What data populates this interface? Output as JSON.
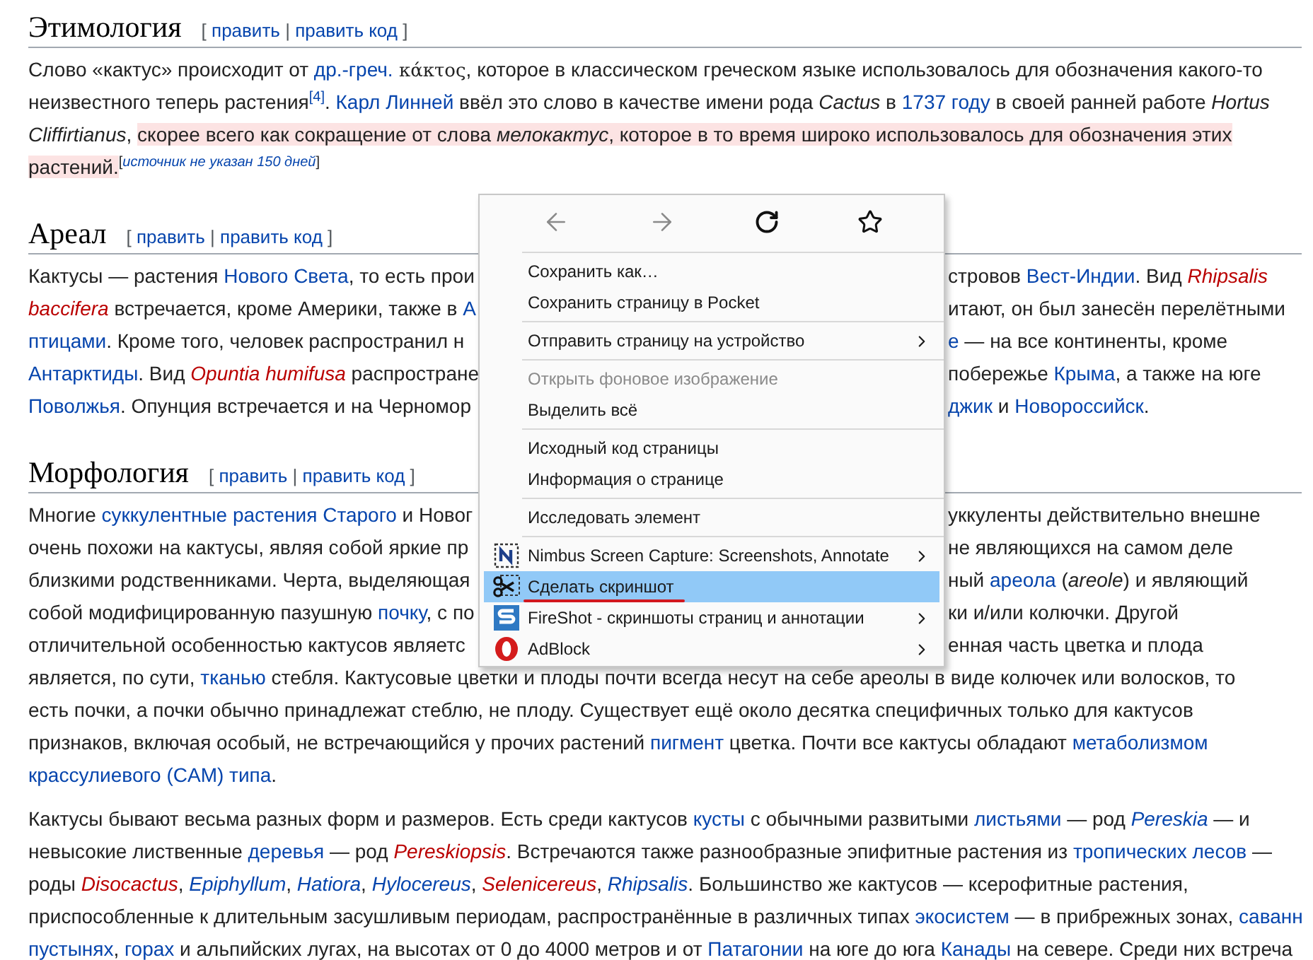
{
  "sections": [
    {
      "title": "Этимология",
      "edit_bar": {
        "open": "[",
        "links": [
          "править",
          "править код"
        ],
        "divider": "|",
        "close": "]"
      },
      "paragraphs": [
        [
          {
            "segments": [
              {
                "text": "Слово «кактус» происходит от ",
                "kind": "plain"
              },
              {
                "text": "др.-греч.",
                "kind": "link"
              },
              {
                "text": " κάκτος",
                "kind": "foreign"
              },
              {
                "text": ", которое в классическом греческом языке использовалось для обозначения какого-то",
                "kind": "plain"
              }
            ]
          },
          {
            "segments": [
              {
                "text": "неизвестного теперь растения",
                "kind": "plain"
              },
              {
                "text": "[4]",
                "kind": "link",
                "sup": true
              },
              {
                "text": ". ",
                "kind": "plain"
              },
              {
                "text": "Карл Линней",
                "kind": "link"
              },
              {
                "text": " ввёл это слово в качестве имени рода ",
                "kind": "plain"
              },
              {
                "text": "Cactus",
                "kind": "plain",
                "italic": true
              },
              {
                "text": " в ",
                "kind": "plain"
              },
              {
                "text": "1737 году",
                "kind": "link"
              },
              {
                "text": " в своей ранней работе ",
                "kind": "plain"
              },
              {
                "text": "Hortus",
                "kind": "plain",
                "italic": true
              }
            ]
          },
          {
            "segments": [
              {
                "text": "Cliffirtianus",
                "kind": "plain",
                "italic": true
              },
              {
                "text": ", ",
                "kind": "plain"
              },
              {
                "text": "скорее всего как сокращение от слова ",
                "kind": "plain",
                "highlighted": true
              },
              {
                "text": "мелокактус",
                "kind": "plain",
                "italic": true,
                "highlighted": true
              },
              {
                "text": ", которое в то время широко использовалось для обозначения этих",
                "kind": "plain",
                "highlighted": true
              }
            ]
          },
          {
            "segments": [
              {
                "text": "растений.",
                "kind": "plain",
                "highlighted": true
              },
              {
                "text": "[",
                "kind": "plain",
                "sup": true
              },
              {
                "text": "источник не указан 150 дней",
                "kind": "link",
                "sup": true,
                "italic": true
              },
              {
                "text": "]",
                "kind": "plain",
                "sup": true
              }
            ]
          }
        ]
      ]
    },
    {
      "title": "Ареал",
      "edit_bar": {
        "open": "[",
        "links": [
          "править",
          "править код"
        ],
        "divider": "|",
        "close": "]"
      },
      "paragraphs": [
        [
          {
            "segments": [
              {
                "text": "Кактусы — растения ",
                "kind": "plain"
              },
              {
                "text": "Нового Света",
                "kind": "link"
              },
              {
                "text": ", то есть прои",
                "kind": "plain"
              }
            ],
            "after_menu": [
              {
                "text": "стровов ",
                "kind": "plain"
              },
              {
                "text": "Вест-Индии",
                "kind": "link"
              },
              {
                "text": ". Вид ",
                "kind": "plain"
              },
              {
                "text": "Rhipsalis",
                "kind": "new_link",
                "italic": true
              }
            ]
          },
          {
            "segments": [
              {
                "text": "baccifera",
                "kind": "new_link",
                "italic": true
              },
              {
                "text": " встречается, кроме Америки, также в ",
                "kind": "plain"
              },
              {
                "text": "А",
                "kind": "link"
              }
            ],
            "after_menu": [
              {
                "text": "итают, он был занесён перелётными",
                "kind": "plain"
              }
            ]
          },
          {
            "segments": [
              {
                "text": "птицами",
                "kind": "link"
              },
              {
                "text": ". Кроме того, человек распространил н",
                "kind": "plain"
              }
            ],
            "after_menu": [
              {
                "text": "е",
                "kind": "link"
              },
              {
                "text": " — на все континенты, кроме",
                "kind": "plain"
              }
            ]
          },
          {
            "segments": [
              {
                "text": "Антарктиды",
                "kind": "link"
              },
              {
                "text": ". Вид ",
                "kind": "plain"
              },
              {
                "text": "Opuntia humifusa",
                "kind": "new_link",
                "italic": true
              },
              {
                "text": " распростране",
                "kind": "plain"
              }
            ],
            "after_menu": [
              {
                "text": "побережье ",
                "kind": "plain"
              },
              {
                "text": "Крыма",
                "kind": "link"
              },
              {
                "text": ", а также на юге",
                "kind": "plain"
              }
            ]
          },
          {
            "segments": [
              {
                "text": "Поволжья",
                "kind": "link"
              },
              {
                "text": ". Опунция встречается и на Черномор",
                "kind": "plain"
              }
            ],
            "after_menu": [
              {
                "text": "джик",
                "kind": "link"
              },
              {
                "text": " и ",
                "kind": "plain"
              },
              {
                "text": "Новороссийск",
                "kind": "link"
              },
              {
                "text": ".",
                "kind": "plain"
              }
            ]
          }
        ]
      ]
    },
    {
      "title": "Морфология",
      "edit_bar": {
        "open": "[",
        "links": [
          "править",
          "править код"
        ],
        "divider": "|",
        "close": "]"
      },
      "paragraphs": [
        [
          {
            "segments": [
              {
                "text": "Многие ",
                "kind": "plain"
              },
              {
                "text": "суккулентные растения Старого",
                "kind": "link"
              },
              {
                "text": " и Новог",
                "kind": "plain"
              }
            ],
            "after_menu": [
              {
                "text": "уккуленты действительно внешне",
                "kind": "plain"
              }
            ]
          },
          {
            "segments": [
              {
                "text": "очень похожи на кактусы, являя собой яркие пр",
                "kind": "plain"
              }
            ],
            "after_menu": [
              {
                "text": "не являющихся на самом деле",
                "kind": "plain"
              }
            ]
          },
          {
            "segments": [
              {
                "text": "близкими родственниками. Черта, выделяющая",
                "kind": "plain"
              }
            ],
            "after_menu": [
              {
                "text": "ный ",
                "kind": "plain"
              },
              {
                "text": "ареола",
                "kind": "link"
              },
              {
                "text": " (",
                "kind": "plain"
              },
              {
                "text": "areole",
                "kind": "plain",
                "italic": true
              },
              {
                "text": ") и являющий",
                "kind": "plain"
              }
            ]
          },
          {
            "segments": [
              {
                "text": "собой модифицированную пазушную ",
                "kind": "plain"
              },
              {
                "text": "почку",
                "kind": "link"
              },
              {
                "text": ", с по",
                "kind": "plain"
              }
            ],
            "after_menu": [
              {
                "text": "ки и/или колючки. Другой",
                "kind": "plain"
              }
            ]
          },
          {
            "segments": [
              {
                "text": "отличительной особенностью кактусов являетс",
                "kind": "plain"
              }
            ],
            "after_menu": [
              {
                "text": "енная часть цветка и плода",
                "kind": "plain"
              }
            ]
          },
          {
            "segments": [
              {
                "text": "является, по сути, ",
                "kind": "plain"
              },
              {
                "text": "тканью",
                "kind": "link"
              },
              {
                "text": " стебля. Кактусовые цветки и плоды почти всегда несут на себе ареолы в виде колючек или волосков, то",
                "kind": "plain"
              }
            ]
          },
          {
            "segments": [
              {
                "text": "есть почки, а почки обычно принадлежат стеблю, не плоду. Существует ещё около десятка специфичных только для кактусов",
                "kind": "plain"
              }
            ]
          },
          {
            "segments": [
              {
                "text": "признаков, включая особый, не встречающийся у прочих растений ",
                "kind": "plain"
              },
              {
                "text": "пигмент",
                "kind": "link"
              },
              {
                "text": " цветка. Почти все кактусы обладают ",
                "kind": "plain"
              },
              {
                "text": "метаболизмом",
                "kind": "link"
              }
            ]
          },
          {
            "segments": [
              {
                "text": "крассулиевого (CAM) типа",
                "kind": "link"
              },
              {
                "text": ".",
                "kind": "plain"
              }
            ]
          }
        ],
        [
          {
            "segments": [
              {
                "text": "Кактусы бывают весьма разных форм и размеров. Есть среди кактусов ",
                "kind": "plain"
              },
              {
                "text": "кусты",
                "kind": "link"
              },
              {
                "text": " с обычными развитыми ",
                "kind": "plain"
              },
              {
                "text": "листьями",
                "kind": "link"
              },
              {
                "text": " — род ",
                "kind": "plain"
              },
              {
                "text": "Pereskia",
                "kind": "link",
                "italic": true
              },
              {
                "text": " — и",
                "kind": "plain"
              }
            ]
          },
          {
            "segments": [
              {
                "text": "невысокие лиственные ",
                "kind": "plain"
              },
              {
                "text": "деревья",
                "kind": "link"
              },
              {
                "text": " — род ",
                "kind": "plain"
              },
              {
                "text": "Pereskiopsis",
                "kind": "new_link",
                "italic": true
              },
              {
                "text": ". Встречаются также разнообразные эпифитные растения из ",
                "kind": "plain"
              },
              {
                "text": "тропических лесов",
                "kind": "link"
              },
              {
                "text": " —",
                "kind": "plain"
              }
            ]
          },
          {
            "segments": [
              {
                "text": "роды ",
                "kind": "plain"
              },
              {
                "text": "Disocactus",
                "kind": "new_link",
                "italic": true
              },
              {
                "text": ", ",
                "kind": "plain"
              },
              {
                "text": "Epiphyllum",
                "kind": "link",
                "italic": true
              },
              {
                "text": ", ",
                "kind": "plain"
              },
              {
                "text": "Hatiora",
                "kind": "link",
                "italic": true
              },
              {
                "text": ", ",
                "kind": "plain"
              },
              {
                "text": "Hylocereus",
                "kind": "link",
                "italic": true
              },
              {
                "text": ", ",
                "kind": "plain"
              },
              {
                "text": "Selenicereus",
                "kind": "new_link",
                "italic": true
              },
              {
                "text": ", ",
                "kind": "plain"
              },
              {
                "text": "Rhipsalis",
                "kind": "link",
                "italic": true
              },
              {
                "text": ". Большинство же кактусов — ксерофитные растения,",
                "kind": "plain"
              }
            ]
          },
          {
            "segments": [
              {
                "text": "приспособленные к длительным засушливым периодам, распространённые в различных типах ",
                "kind": "plain"
              },
              {
                "text": "экосистем",
                "kind": "link"
              },
              {
                "text": " — в прибрежных зонах, ",
                "kind": "plain"
              },
              {
                "text": "саванн",
                "kind": "link"
              }
            ]
          },
          {
            "segments": [
              {
                "text": "пустынях",
                "kind": "link"
              },
              {
                "text": ", ",
                "kind": "plain"
              },
              {
                "text": "горах",
                "kind": "link"
              },
              {
                "text": " и альпийских лугах, на высотах от 0 до 4000 метров и от ",
                "kind": "plain"
              },
              {
                "text": "Патагонии",
                "kind": "link"
              },
              {
                "text": " на юге до юга ",
                "kind": "plain"
              },
              {
                "text": "Канады",
                "kind": "link"
              },
              {
                "text": " на севере. Среди них встреча",
                "kind": "plain"
              }
            ]
          }
        ]
      ]
    }
  ],
  "context_menu": {
    "nav": [
      {
        "kind": "back",
        "disabled": true
      },
      {
        "kind": "forward",
        "disabled": true
      },
      {
        "kind": "reload",
        "disabled": false
      },
      {
        "kind": "bookmark",
        "disabled": false
      }
    ],
    "groups": [
      [
        {
          "label": "Сохранить как…",
          "kind": "plain",
          "disabled": false,
          "selected": false,
          "submenu": false,
          "underlined": false
        },
        {
          "label": "Сохранить страницу в Pocket",
          "kind": "plain",
          "disabled": false,
          "selected": false,
          "submenu": false,
          "underlined": false
        }
      ],
      [
        {
          "label": "Отправить страницу на устройство",
          "kind": "plain",
          "disabled": false,
          "selected": false,
          "submenu": true,
          "underlined": false
        }
      ],
      [
        {
          "label": "Открыть фоновое изображение",
          "kind": "plain",
          "disabled": true,
          "selected": false,
          "submenu": false,
          "underlined": false
        },
        {
          "label": "Выделить всё",
          "kind": "plain",
          "disabled": false,
          "selected": false,
          "submenu": false,
          "underlined": false
        }
      ],
      [
        {
          "label": "Исходный код страницы",
          "kind": "plain",
          "disabled": false,
          "selected": false,
          "submenu": false,
          "underlined": false
        },
        {
          "label": "Информация о странице",
          "kind": "plain",
          "disabled": false,
          "selected": false,
          "submenu": false,
          "underlined": false
        }
      ],
      [
        {
          "label": "Исследовать элемент",
          "kind": "plain",
          "disabled": false,
          "selected": false,
          "submenu": false,
          "underlined": false
        }
      ],
      [
        {
          "label": "Nimbus Screen Capture: Screenshots, Annotate",
          "kind": "nimbus",
          "disabled": false,
          "selected": false,
          "submenu": true,
          "underlined": false
        },
        {
          "label": "Сделать скриншот",
          "kind": "scissors",
          "disabled": false,
          "selected": true,
          "submenu": false,
          "underlined": true
        },
        {
          "label": "FireShot - скриншоты страниц и аннотации",
          "kind": "fireshot",
          "disabled": false,
          "selected": false,
          "submenu": true,
          "underlined": false
        },
        {
          "label": "AdBlock",
          "kind": "adblock",
          "disabled": false,
          "selected": false,
          "submenu": true,
          "underlined": false
        }
      ]
    ]
  }
}
